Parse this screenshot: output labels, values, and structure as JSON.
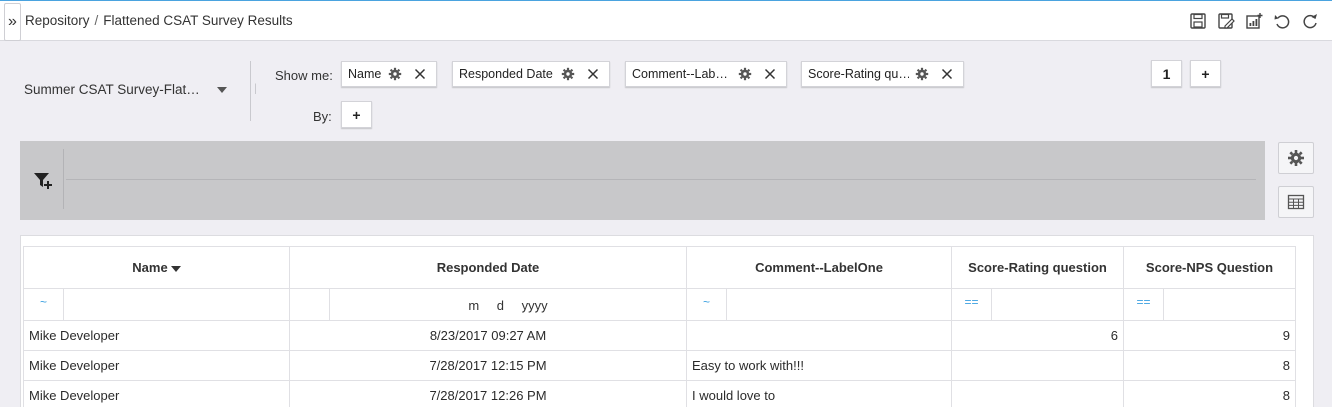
{
  "breadcrumb": {
    "root": "Repository",
    "separator": "/",
    "current": "Flattened CSAT Survey Results"
  },
  "toolbar": {
    "expand_glyph": "»",
    "icons": [
      "save-icon",
      "save-as-icon",
      "add-chart-icon",
      "undo-icon",
      "refresh-icon"
    ]
  },
  "report": {
    "selected": "Summer CSAT Survey-Flat…"
  },
  "show_me": {
    "label": "Show me:",
    "chips": [
      {
        "label": "Name"
      },
      {
        "label": "Responded Date"
      },
      {
        "label": "Comment--Lab…"
      },
      {
        "label": "Score-Rating qu…"
      }
    ]
  },
  "by": {
    "label": "By:",
    "add": "+"
  },
  "group_controls": {
    "count": "1",
    "add": "+"
  },
  "grid": {
    "columns": [
      "Name",
      "Responded Date",
      "Comment--LabelOne",
      "Score-Rating question",
      "Score-NPS Question"
    ],
    "filters": {
      "name_op": "~",
      "date_placeholder": "m d yyyy",
      "comment_op": "~",
      "rating_op": "==",
      "nps_op": "=="
    },
    "rows": [
      {
        "name": "Mike Developer",
        "date": "8/23/2017 09:27 AM",
        "comment": "",
        "rating": "6",
        "nps": "9"
      },
      {
        "name": "Mike Developer",
        "date": "7/28/2017 12:15 PM",
        "comment": "Easy to work with!!!",
        "rating": "",
        "nps": "8"
      },
      {
        "name": "Mike Developer",
        "date": "7/28/2017 12:26 PM",
        "comment": "I would love to",
        "rating": "",
        "nps": "8"
      }
    ]
  },
  "colors": {
    "accent": "#3aa0e0",
    "filter_bar": "#c8c8ca",
    "background": "#efeef3"
  }
}
